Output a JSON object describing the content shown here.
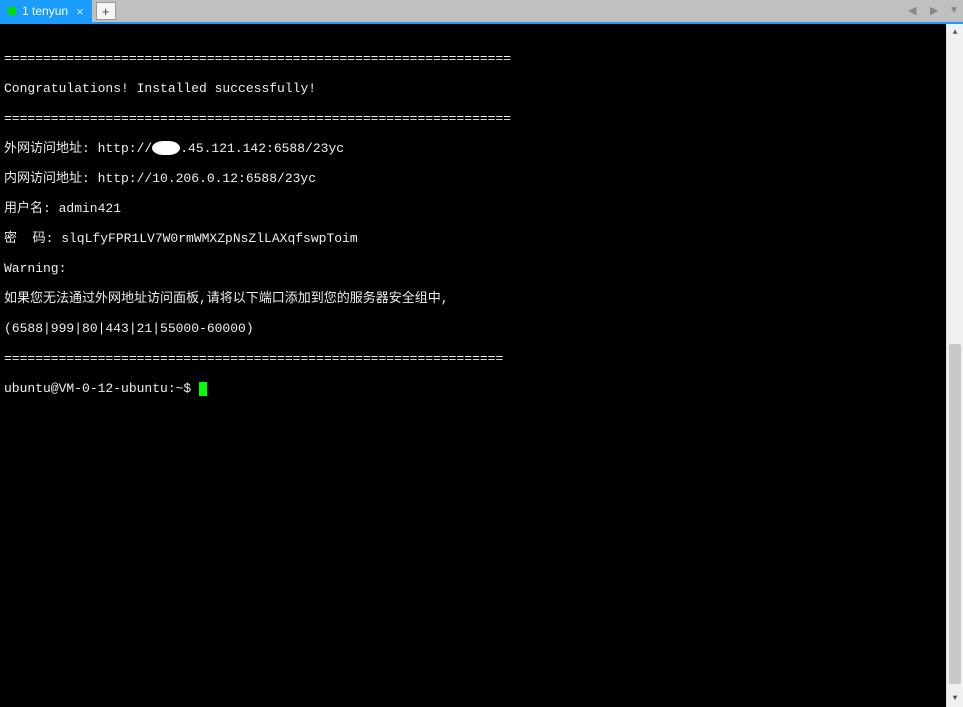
{
  "tabs": {
    "active": {
      "number": "1",
      "title": "tenyun"
    },
    "new_tab_label": "+"
  },
  "terminal": {
    "sep1": "=================================================================",
    "congrats": "Congratulations! Installed successfully!",
    "sep2": "=================================================================",
    "external_label": "外网访问地址: http://",
    "external_suffix": ".45.121.142:6588/23yc",
    "internal": "内网访问地址: http://10.206.0.12:6588/23yc",
    "username": "用户名: admin421",
    "password": "密  码: slqLfyFPR1LV7W0rmWMXZpNsZlLAXqfswpToim",
    "warning": "Warning:",
    "warn_line1": "如果您无法通过外网地址访问面板,请将以下端口添加到您的服务器安全组中,",
    "warn_line2": "(6588|999|80|443|21|55000-60000)",
    "sep3": "================================================================",
    "prompt": "ubuntu@VM-0-12-ubuntu:~$ "
  }
}
